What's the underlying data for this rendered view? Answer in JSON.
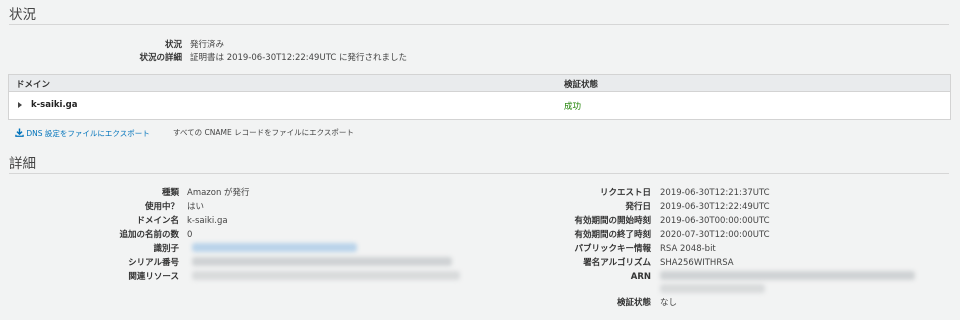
{
  "status": {
    "heading": "状況",
    "rows": [
      {
        "label": "状況",
        "value": "発行済み"
      },
      {
        "label": "状況の詳細",
        "value": "証明書は 2019-06-30T12:22:49UTC に発行されました"
      }
    ]
  },
  "table": {
    "headers": {
      "domain": "ドメイン",
      "validation": "検証状態"
    },
    "rows": [
      {
        "domain": "k-saiki.ga",
        "validation": "成功"
      }
    ]
  },
  "export": {
    "dns_link": "DNS 設定をファイルにエクスポート",
    "cname_text": "すべての CNAME レコードをファイルにエクスポート"
  },
  "details": {
    "heading": "詳細",
    "left": [
      {
        "label": "種類",
        "value": "Amazon が発行"
      },
      {
        "label": "使用中？",
        "value": "はい"
      },
      {
        "label": "ドメイン名",
        "value": "k-saiki.ga"
      },
      {
        "label": "追加の名前の数",
        "value": "0"
      },
      {
        "label": "識別子",
        "value": ""
      },
      {
        "label": "シリアル番号",
        "value": ""
      },
      {
        "label": "関連リソース",
        "value": ""
      }
    ],
    "right": [
      {
        "label": "リクエスト日",
        "value": "2019-06-30T12:21:37UTC"
      },
      {
        "label": "発行日",
        "value": "2019-06-30T12:22:49UTC"
      },
      {
        "label": "有効期間の開始時刻",
        "value": "2019-06-30T00:00:00UTC"
      },
      {
        "label": "有効期間の終了時刻",
        "value": "2020-07-30T12:00:00UTC"
      },
      {
        "label": "パブリックキー情報",
        "value": "RSA 2048-bit"
      },
      {
        "label": "署名アルゴリズム",
        "value": "SHA256WITHRSA"
      },
      {
        "label": "ARN",
        "value": ""
      },
      {
        "label": "検証状態",
        "value": "なし"
      }
    ]
  },
  "colors": {
    "link": "#0073bb",
    "success": "#1d8102",
    "background": "#f2f3f3"
  }
}
